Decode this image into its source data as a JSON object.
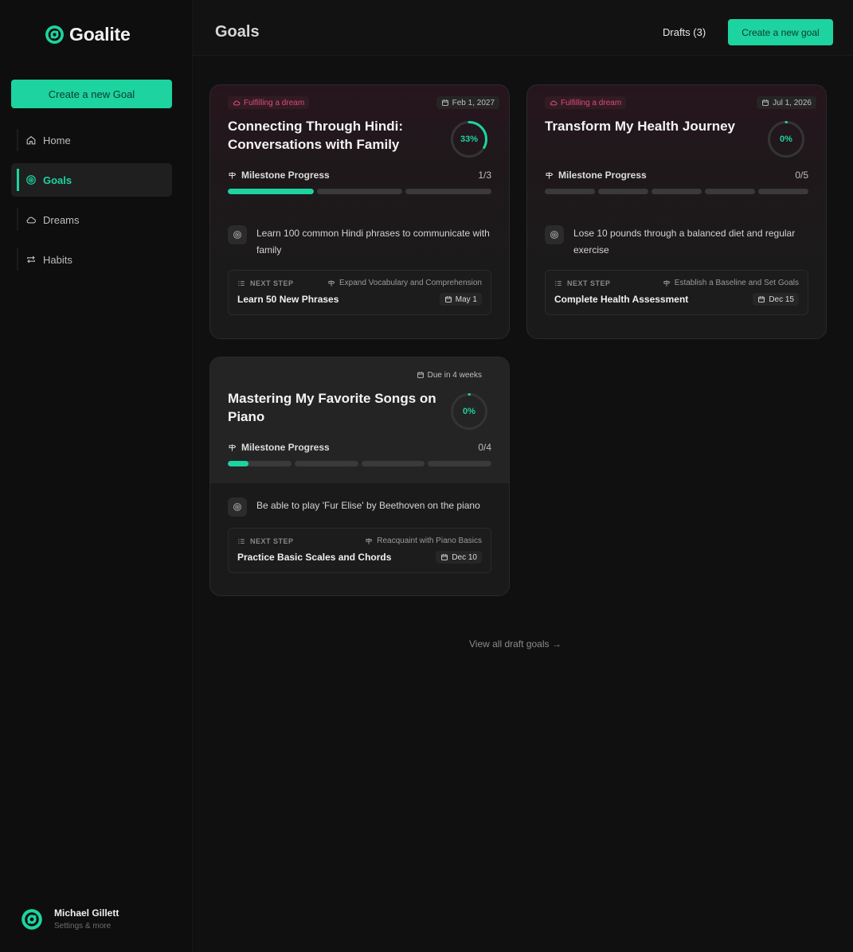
{
  "brand": {
    "name": "Goalite"
  },
  "sidebar": {
    "cta_label": "Create a new Goal",
    "items": [
      {
        "label": "Home",
        "icon": "home-icon"
      },
      {
        "label": "Goals",
        "icon": "target-icon",
        "active": true
      },
      {
        "label": "Dreams",
        "icon": "cloud-icon"
      },
      {
        "label": "Habits",
        "icon": "repeat-icon"
      }
    ],
    "user": {
      "name": "Michael Gillett",
      "subtitle": "Settings & more"
    }
  },
  "header": {
    "title": "Goals",
    "drafts_label": "Drafts (3)",
    "cta_label": "Create a new goal"
  },
  "colors": {
    "accent": "#1dd3a0",
    "dream": "#e04a78"
  },
  "goals": [
    {
      "tag": "Fulfilling a dream",
      "date": "Feb 1, 2027",
      "title": "Connecting Through Hindi: Conversations with Family",
      "progress_label": "33%",
      "progress": 0.33,
      "milestone_label": "Milestone Progress",
      "milestone_count": "1/3",
      "milestones_done": 1,
      "milestones_total": 3,
      "objective": "Learn 100 common Hindi phrases to communicate with family",
      "next_step_label": "NEXT STEP",
      "next_milestone": "Expand Vocabulary and Comprehension",
      "next_title": "Learn 50 New Phrases",
      "next_date": "May 1"
    },
    {
      "tag": "Fulfilling a dream",
      "date": "Jul 1, 2026",
      "title": "Transform My Health Journey",
      "progress_label": "0%",
      "progress": 0,
      "milestone_label": "Milestone Progress",
      "milestone_count": "0/5",
      "milestones_done": 0,
      "milestones_total": 5,
      "objective": "Lose 10 pounds through a balanced diet and regular exercise",
      "next_step_label": "NEXT STEP",
      "next_milestone": "Establish a Baseline and Set Goals",
      "next_title": "Complete Health Assessment",
      "next_date": "Dec 15"
    },
    {
      "tag": "",
      "date": "Due in 4 weeks",
      "title": "Mastering My Favorite Songs on Piano",
      "progress_label": "0%",
      "progress": 0,
      "milestone_label": "Milestone Progress",
      "milestone_count": "0/4",
      "milestones_done": 0,
      "milestones_total": 4,
      "first_segment_partial": 0.33,
      "objective": "Be able to play 'Fur Elise' by Beethoven on the piano",
      "next_step_label": "NEXT STEP",
      "next_milestone": "Reacquaint with Piano Basics",
      "next_title": "Practice Basic Scales and Chords",
      "next_date": "Dec 10"
    }
  ],
  "footer_link": "View all draft goals →"
}
